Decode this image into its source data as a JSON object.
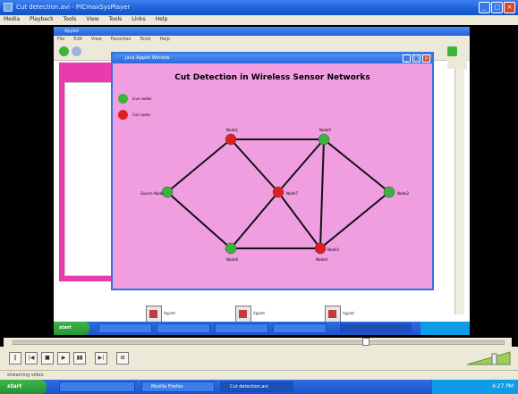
{
  "player": {
    "title": "Cut detection.avi - PICmaxSysPlayer",
    "menu": [
      "Media",
      "Playback",
      "Tools",
      "View",
      "Tools",
      "Links",
      "Help"
    ],
    "controls": [
      "prev",
      "stop-back",
      "play",
      "stop",
      "frame",
      "next"
    ],
    "status_text": "streaming video",
    "seek_position": 0.72
  },
  "inner_desktop": {
    "ie_title": "Applet",
    "ie_menu": [
      "File",
      "Edit",
      "View",
      "Favorites",
      "Tools",
      "Help"
    ],
    "desktop_icons": [
      {
        "label": "Applet"
      },
      {
        "label": "Applet"
      },
      {
        "label": "Applet"
      }
    ],
    "taskbar": {
      "start_label": "start"
    }
  },
  "applet": {
    "window_title": "Java Applet Window",
    "heading": "Cut Detection in Wireless Sensor Networks",
    "legend": [
      {
        "label": "Live nodes",
        "color": "#3cb43c"
      },
      {
        "label": "Cut nodes",
        "color": "#dc2020"
      }
    ],
    "nodes": [
      {
        "id": "source",
        "label": "Source Node",
        "state": "live"
      },
      {
        "id": "n1",
        "label": "Node1",
        "state": "cut"
      },
      {
        "id": "n2",
        "label": "Node2",
        "state": "live"
      },
      {
        "id": "n3",
        "label": "Node3",
        "state": "cut"
      },
      {
        "id": "n4",
        "label": "Node4",
        "state": "cut"
      },
      {
        "id": "n5",
        "label": "Node5",
        "state": "live"
      },
      {
        "id": "n6",
        "label": "Node6",
        "state": "live"
      },
      {
        "id": "n7",
        "label": "Node7",
        "state": "cut"
      }
    ],
    "edges": [
      [
        "source",
        "n1"
      ],
      [
        "source",
        "n6"
      ],
      [
        "n1",
        "n5"
      ],
      [
        "n1",
        "n7"
      ],
      [
        "n5",
        "n7"
      ],
      [
        "n5",
        "n2"
      ],
      [
        "n6",
        "n7"
      ],
      [
        "n6",
        "n4"
      ],
      [
        "n7",
        "n4"
      ],
      [
        "n4",
        "n3"
      ],
      [
        "n5",
        "n4"
      ],
      [
        "n2",
        "n3"
      ]
    ],
    "colors": {
      "live": "#3cb43c",
      "cut": "#dc2020",
      "background": "#f09ee0"
    }
  },
  "outer_taskbar": {
    "start_label": "start",
    "tasks": [
      "Mozilla Firefox",
      "Cut detection.avi"
    ],
    "clock": "4:27 PM"
  }
}
